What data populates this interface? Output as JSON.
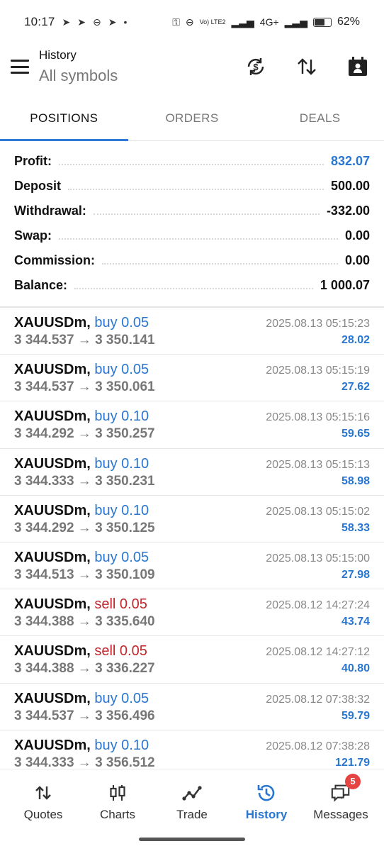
{
  "status": {
    "time": "10:17",
    "left_icons": [
      "telegram-icon",
      "telegram-icon",
      "app-icon",
      "telegram-icon",
      "dot-icon"
    ],
    "network": "4G+",
    "volte": "Vo) LTE2",
    "battery": "62%"
  },
  "appbar": {
    "title": "History",
    "subtitle": "All symbols",
    "icons": [
      "currency-refresh-icon",
      "sort-icon",
      "calendar-icon"
    ]
  },
  "tabs": [
    {
      "label": "POSITIONS",
      "active": true
    },
    {
      "label": "ORDERS",
      "active": false
    },
    {
      "label": "DEALS",
      "active": false
    }
  ],
  "summary": [
    {
      "label": "Profit:",
      "value": "832.07",
      "accent": true
    },
    {
      "label": "Deposit",
      "value": "500.00"
    },
    {
      "label": "Withdrawal:",
      "value": "-332.00"
    },
    {
      "label": "Swap:",
      "value": "0.00"
    },
    {
      "label": "Commission:",
      "value": "0.00"
    },
    {
      "label": "Balance:",
      "value": "1 000.07"
    }
  ],
  "rows": [
    {
      "symbol": "XAUUSDm,",
      "dir": "buy 0.05",
      "side": "buy",
      "price": "3 344.537 → 3 350.141",
      "time": "2025.08.13 05:15:23",
      "profit": "28.02"
    },
    {
      "symbol": "XAUUSDm,",
      "dir": "buy 0.05",
      "side": "buy",
      "price": "3 344.537 → 3 350.061",
      "time": "2025.08.13 05:15:19",
      "profit": "27.62"
    },
    {
      "symbol": "XAUUSDm,",
      "dir": "buy 0.10",
      "side": "buy",
      "price": "3 344.292 → 3 350.257",
      "time": "2025.08.13 05:15:16",
      "profit": "59.65"
    },
    {
      "symbol": "XAUUSDm,",
      "dir": "buy 0.10",
      "side": "buy",
      "price": "3 344.333 → 3 350.231",
      "time": "2025.08.13 05:15:13",
      "profit": "58.98"
    },
    {
      "symbol": "XAUUSDm,",
      "dir": "buy 0.10",
      "side": "buy",
      "price": "3 344.292 → 3 350.125",
      "time": "2025.08.13 05:15:02",
      "profit": "58.33"
    },
    {
      "symbol": "XAUUSDm,",
      "dir": "buy 0.05",
      "side": "buy",
      "price": "3 344.513 → 3 350.109",
      "time": "2025.08.13 05:15:00",
      "profit": "27.98"
    },
    {
      "symbol": "XAUUSDm,",
      "dir": "sell 0.05",
      "side": "sell",
      "price": "3 344.388 → 3 335.640",
      "time": "2025.08.12 14:27:24",
      "profit": "43.74"
    },
    {
      "symbol": "XAUUSDm,",
      "dir": "sell 0.05",
      "side": "sell",
      "price": "3 344.388 → 3 336.227",
      "time": "2025.08.12 14:27:12",
      "profit": "40.80"
    },
    {
      "symbol": "XAUUSDm,",
      "dir": "buy 0.05",
      "side": "buy",
      "price": "3 344.537 → 3 356.496",
      "time": "2025.08.12 07:38:32",
      "profit": "59.79"
    },
    {
      "symbol": "XAUUSDm,",
      "dir": "buy 0.10",
      "side": "buy",
      "price": "3 344.333 → 3 356.512",
      "time": "2025.08.12 07:38:28",
      "profit": "121.79"
    }
  ],
  "nav": [
    {
      "label": "Quotes",
      "icon": "quotes-icon",
      "active": false
    },
    {
      "label": "Charts",
      "icon": "charts-icon",
      "active": false
    },
    {
      "label": "Trade",
      "icon": "trade-icon",
      "active": false
    },
    {
      "label": "History",
      "icon": "history-icon",
      "active": true
    },
    {
      "label": "Messages",
      "icon": "messages-icon",
      "active": false,
      "badge": "5"
    }
  ],
  "colors": {
    "accent": "#2876d0",
    "sell": "#c0262b",
    "badge": "#e64343"
  }
}
